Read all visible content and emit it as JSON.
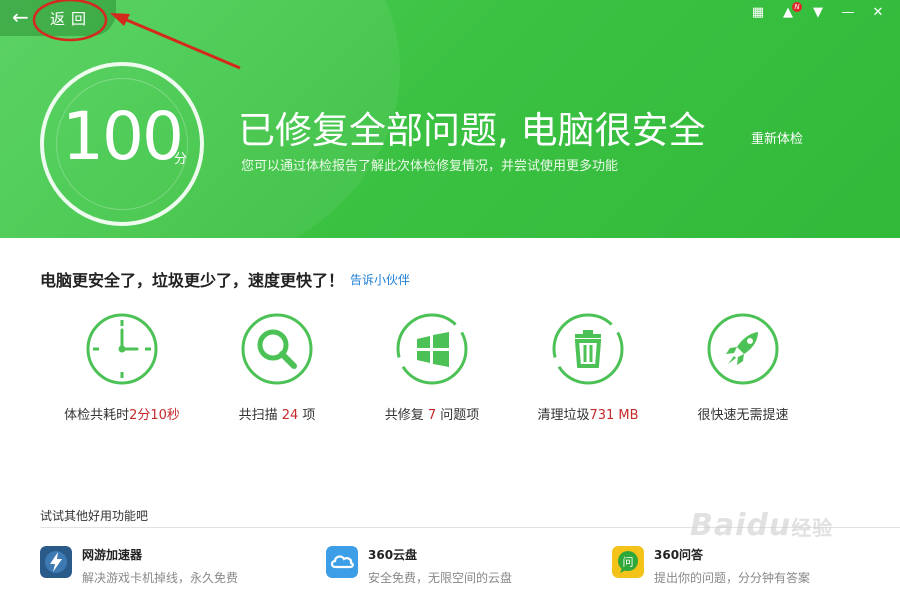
{
  "header": {
    "back_label": "返回",
    "score": "100",
    "score_unit": "分",
    "headline": "已修复全部问题, 电脑很安全",
    "subline": "您可以通过体检报告了解此次体检修复情况，并尝试使用更多功能",
    "recheck_label": "重新体检",
    "badge": "N"
  },
  "summary": {
    "text": "电脑更安全了，垃圾更少了，速度更快了！",
    "share_link": "告诉小伙伴"
  },
  "stats": [
    {
      "label_pre": "体检共耗时",
      "value": "2分10秒",
      "label_post": "",
      "icon": "clock-icon"
    },
    {
      "label_pre": "共扫描 ",
      "value": "24",
      "label_post": " 项",
      "icon": "magnifier-icon"
    },
    {
      "label_pre": "共修复 ",
      "value": "7",
      "label_post": " 问题项",
      "icon": "windows-logo-icon"
    },
    {
      "label_pre": "清理垃圾",
      "value": "731 MB",
      "label_post": "",
      "icon": "trash-icon"
    },
    {
      "label_pre": "很快速无需提速",
      "value": "",
      "label_post": "",
      "icon": "rocket-icon"
    }
  ],
  "others": {
    "title": "试试其他好用功能吧",
    "tools": [
      {
        "name": "网游加速器",
        "desc": "解决游戏卡机掉线，永久免费",
        "icon": "lightning-icon",
        "color": "#2a5a8a"
      },
      {
        "name": "360云盘",
        "desc": "安全免费，无限空间的云盘",
        "icon": "cloud-icon",
        "color": "#3b9ee6"
      },
      {
        "name": "360问答",
        "desc": "提出你的问题，分分钟有答案",
        "icon": "qa-bubble-icon",
        "color": "#f4c319"
      }
    ]
  },
  "watermark": {
    "brand": "Baidu",
    "suffix": "经验"
  },
  "colors": {
    "header_green": "#3cc243",
    "stat_green": "#4cc155",
    "highlight_red": "#c62a2a",
    "link_blue": "#1e7fd4"
  }
}
